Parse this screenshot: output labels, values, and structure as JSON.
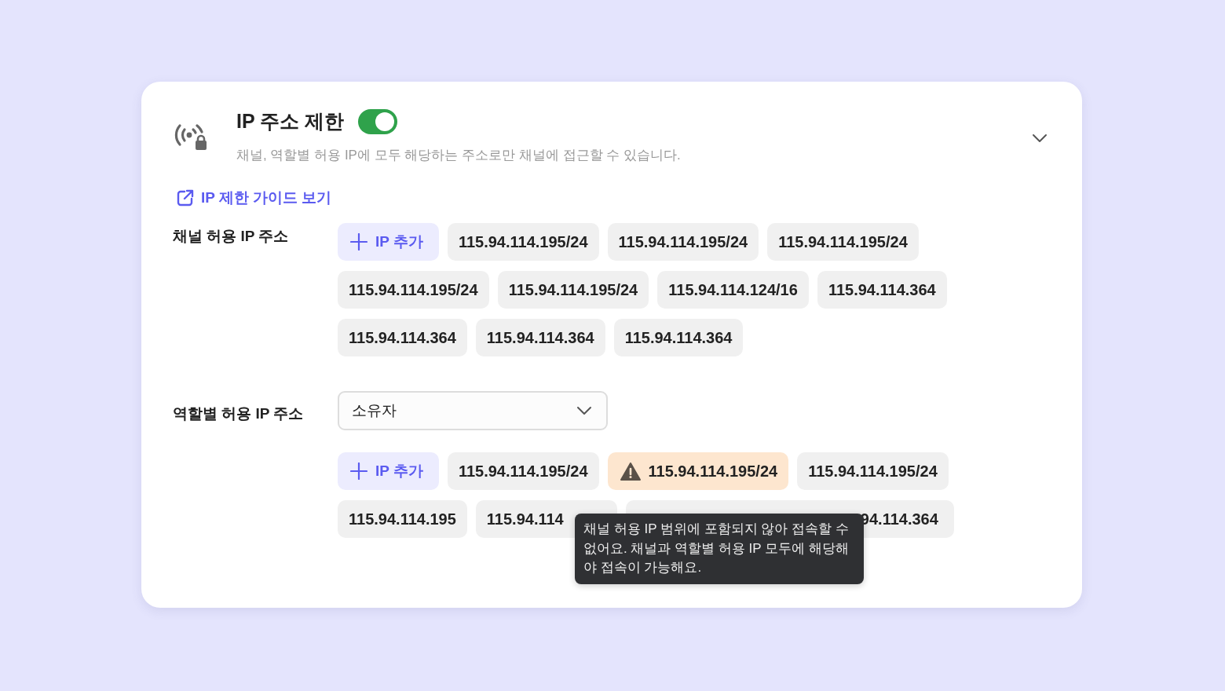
{
  "header": {
    "title": "IP 주소 제한",
    "enabled": true,
    "description": "채널, 역할별 허용 IP에 모두 해당하는 주소로만 채널에 접근할 수 있습니다."
  },
  "guide_link": "IP 제한 가이드 보기",
  "sections": [
    {
      "label": "채널 허용 IP 주소",
      "add_button": "IP 추가",
      "chips": [
        {
          "text": "115.94.114.195/24",
          "kind": "ip"
        },
        {
          "text": "115.94.114.195/24",
          "kind": "ip"
        },
        {
          "text": "115.94.114.195/24",
          "kind": "ip"
        },
        {
          "text": "115.94.114.195/24",
          "kind": "ip"
        },
        {
          "text": "115.94.114.195/24",
          "kind": "ip"
        },
        {
          "text": "115.94.114.124/16",
          "kind": "ip"
        },
        {
          "text": "115.94.114.364",
          "kind": "ip"
        },
        {
          "text": "115.94.114.364",
          "kind": "ip"
        },
        {
          "text": "115.94.114.364",
          "kind": "ip"
        },
        {
          "text": "115.94.114.364",
          "kind": "ip"
        }
      ]
    },
    {
      "label": "역할별 허용 IP 주소",
      "dropdown": {
        "value": "소유자"
      },
      "add_button": "IP 추가",
      "chips": [
        {
          "text": "115.94.114.195/24",
          "kind": "ip"
        },
        {
          "text": "115.94.114.195/24",
          "kind": "warning"
        },
        {
          "text": "115.94.114.195/24",
          "kind": "ip"
        },
        {
          "text": "115.94.114.195",
          "kind": "ip"
        },
        {
          "text": "115.94.114",
          "kind": "covered_end"
        },
        {
          "text": "94.114.364",
          "kind": "covered_start"
        }
      ]
    }
  ],
  "tooltip": "채널 허용 IP 범위에 포함되지 않아 접속할 수 없어요. 채널과 역할별 허용 IP 모두에 해당해야 접속이 가능해요."
}
